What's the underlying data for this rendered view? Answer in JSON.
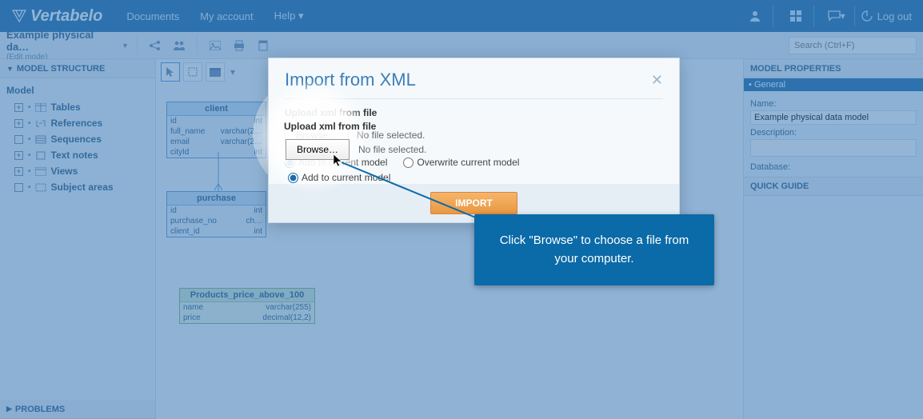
{
  "topnav": {
    "brand": "Vertabelo",
    "links": [
      "Documents",
      "My account",
      "Help"
    ],
    "logout": "Log out"
  },
  "toolbar": {
    "doc_title": "Example physical da…",
    "edit_mode": "(Edit mode)",
    "search_placeholder": "Search (Ctrl+F)"
  },
  "left": {
    "structure_hd": "MODEL STRUCTURE",
    "root": "Model",
    "nodes": [
      "Tables",
      "References",
      "Sequences",
      "Text notes",
      "Views",
      "Subject areas"
    ],
    "problems_hd": "PROBLEMS"
  },
  "tables": {
    "client": {
      "name": "client",
      "rows": [
        [
          "id",
          "int"
        ],
        [
          "full_name",
          "varchar(2…"
        ],
        [
          "email",
          "varchar(2…"
        ],
        [
          "cityId",
          "int"
        ]
      ]
    },
    "purchase": {
      "name": "purchase",
      "rows": [
        [
          "id",
          "int"
        ],
        [
          "purchase_no",
          "ch…"
        ],
        [
          "client_id",
          "int"
        ]
      ]
    },
    "products": {
      "name": "Products_price_above_100",
      "rows": [
        [
          "name",
          "varchar(255)"
        ],
        [
          "price",
          "decimal(12,2)"
        ]
      ]
    }
  },
  "right": {
    "hd": "MODEL PROPERTIES",
    "general": "General",
    "name_lbl": "Name:",
    "name_val": "Example physical data model",
    "desc_lbl": "Description:",
    "db_lbl": "Database:",
    "quick_hd": "QUICK GUIDE"
  },
  "modal": {
    "title": "Import from XML",
    "upload_lbl": "Upload xml from file",
    "browse": "Browse…",
    "no_file": "No file selected.",
    "radio_add": "Add to current model",
    "radio_over": "Overwrite current model",
    "import": "IMPORT"
  },
  "tooltip": {
    "text": "Click \"Browse\" to choose a file from your computer."
  }
}
